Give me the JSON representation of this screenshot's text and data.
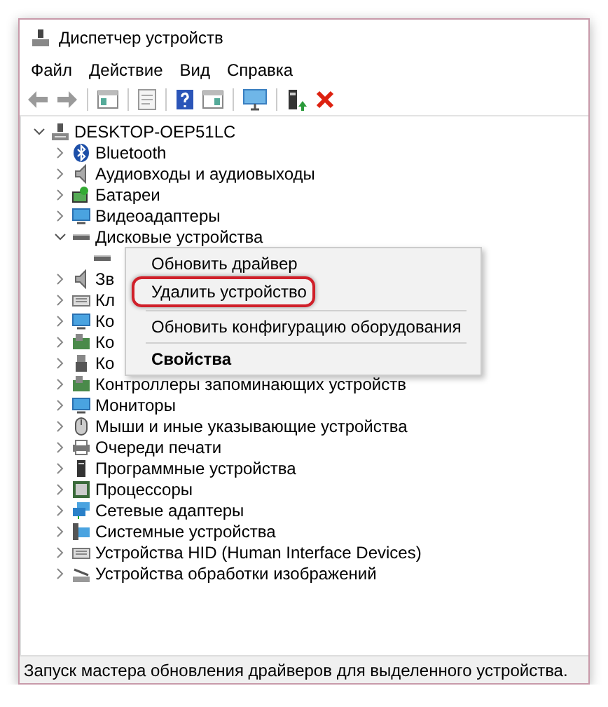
{
  "window": {
    "title": "Диспетчер устройств"
  },
  "menu": [
    "Файл",
    "Действие",
    "Вид",
    "Справка"
  ],
  "toolbar": [
    {
      "kind": "back"
    },
    {
      "kind": "forward"
    },
    {
      "kind": "sep"
    },
    {
      "kind": "pane"
    },
    {
      "kind": "sep"
    },
    {
      "kind": "sheet"
    },
    {
      "kind": "sep"
    },
    {
      "kind": "help"
    },
    {
      "kind": "pane2"
    },
    {
      "kind": "sep"
    },
    {
      "kind": "monitor"
    },
    {
      "kind": "sep"
    },
    {
      "kind": "driver"
    },
    {
      "kind": "remove"
    }
  ],
  "tree": [
    {
      "label": "DESKTOP-OEP51LC",
      "kind": "computer",
      "expanded": true,
      "children": [
        {
          "label": "Bluetooth",
          "kind": "bluetooth",
          "expanded": false
        },
        {
          "label": "Аудиовходы и аудиовыходы",
          "kind": "speaker",
          "expanded": false
        },
        {
          "label": "Батареи",
          "kind": "battery",
          "expanded": false
        },
        {
          "label": "Видеоадаптеры",
          "kind": "display",
          "expanded": false
        },
        {
          "label": "Дисковые устройства",
          "kind": "disk",
          "expanded": true,
          "children": [
            {
              "kind": "disk"
            }
          ]
        },
        {
          "label": "Зв",
          "kind": "speaker",
          "expanded": false
        },
        {
          "label": "Кл",
          "kind": "keyboard",
          "expanded": false
        },
        {
          "label": "Ко",
          "kind": "display",
          "expanded": false
        },
        {
          "label": "Ко",
          "kind": "board",
          "expanded": false
        },
        {
          "label": "Ко",
          "kind": "usb",
          "expanded": false
        },
        {
          "label": "Контроллеры запоминающих устройств",
          "kind": "board",
          "expanded": false
        },
        {
          "label": "Мониторы",
          "kind": "display",
          "expanded": false
        },
        {
          "label": "Мыши и иные указывающие устройства",
          "kind": "mouse",
          "expanded": false
        },
        {
          "label": "Очереди печати",
          "kind": "printer",
          "expanded": false
        },
        {
          "label": "Программные устройства",
          "kind": "tower",
          "expanded": false
        },
        {
          "label": "Процессоры",
          "kind": "chip",
          "expanded": false
        },
        {
          "label": "Сетевые адаптеры",
          "kind": "network",
          "expanded": false
        },
        {
          "label": "Системные устройства",
          "kind": "system",
          "expanded": false
        },
        {
          "label": "Устройства HID (Human Interface Devices)",
          "kind": "keyboard",
          "expanded": false
        },
        {
          "label": "Устройства обработки изображений",
          "kind": "camera",
          "expanded": false
        }
      ]
    }
  ],
  "context_menu": [
    {
      "label": "Обновить драйвер",
      "kind": "item",
      "bold": false,
      "highlighted": false
    },
    {
      "label": "Удалить устройство",
      "kind": "item",
      "bold": false,
      "highlighted": true
    },
    {
      "kind": "separator"
    },
    {
      "label": "Обновить конфигурацию оборудования",
      "kind": "item",
      "bold": false,
      "highlighted": false
    },
    {
      "kind": "separator"
    },
    {
      "label": "Свойства",
      "kind": "item",
      "bold": true,
      "highlighted": false
    }
  ],
  "status_bar": "Запуск мастера обновления драйверов для выделенного устройства."
}
